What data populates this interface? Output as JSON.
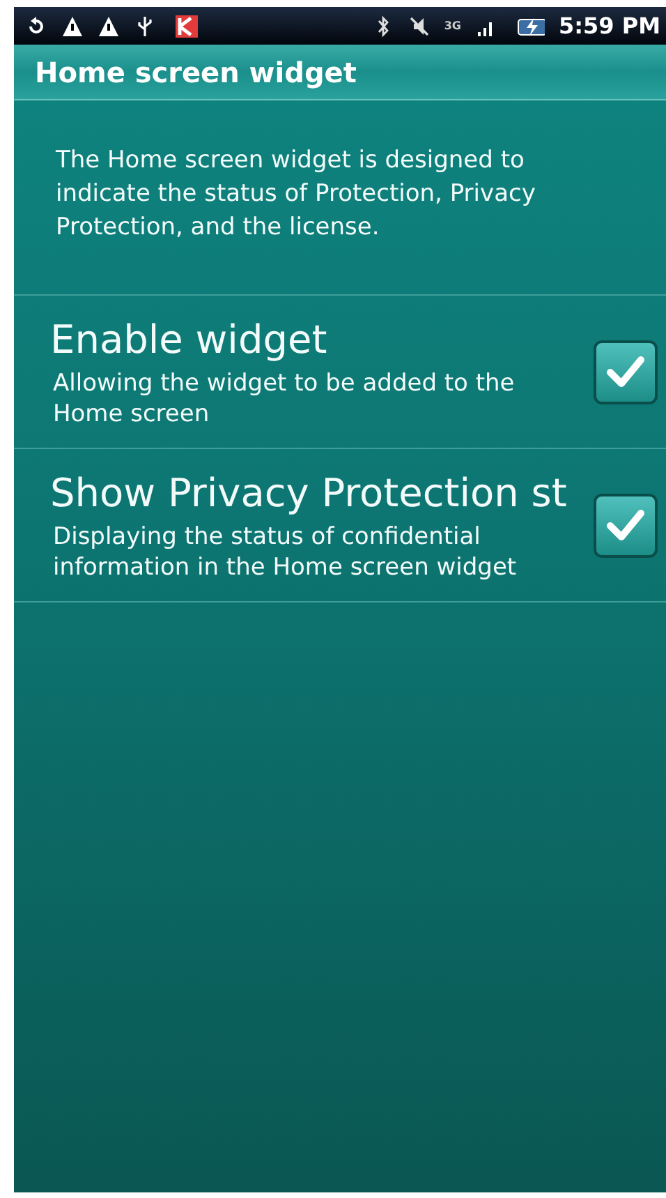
{
  "status_bar": {
    "network": "3G",
    "time": "5:59 PM"
  },
  "title": "Home screen widget",
  "description": "The Home screen widget is designed to indicate the status of Protection, Privacy Protection, and the license.",
  "settings": [
    {
      "title": "Enable widget",
      "summary": "Allowing the widget to be added to the Home screen",
      "checked": true
    },
    {
      "title": "Show Privacy Protection st",
      "summary": "Displaying the status of confidential information in the Home screen widget",
      "checked": true
    }
  ]
}
